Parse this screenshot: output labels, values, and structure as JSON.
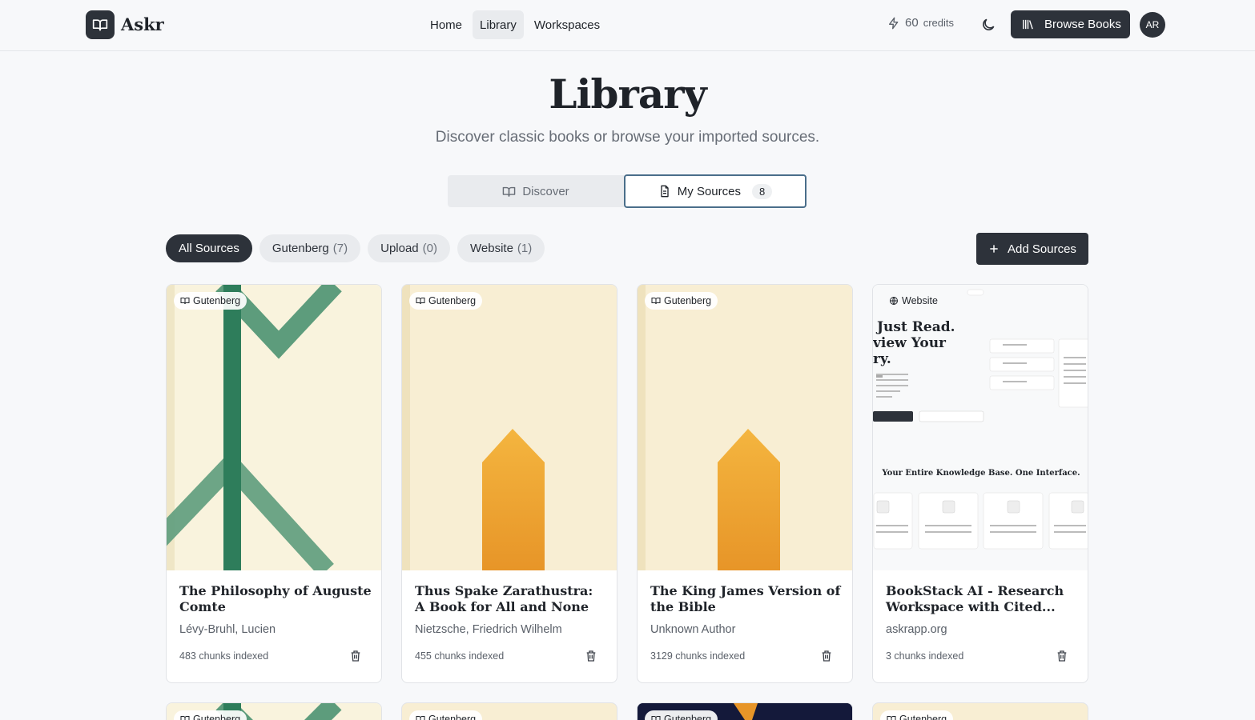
{
  "app": {
    "name": "Askr"
  },
  "nav": [
    {
      "label": "Home",
      "active": false
    },
    {
      "label": "Library",
      "active": true
    },
    {
      "label": "Workspaces",
      "active": false
    }
  ],
  "header": {
    "credits_value": "60",
    "credits_unit": "credits",
    "browse_label": "Browse Books",
    "avatar_initials": "AR"
  },
  "page": {
    "title": "Library",
    "subtitle": "Discover classic books or browse your imported sources."
  },
  "toggle": {
    "discover_label": "Discover",
    "sources_label": "My Sources",
    "sources_count": "8"
  },
  "filters": [
    {
      "label": "All Sources",
      "count": "",
      "active": true
    },
    {
      "label": "Gutenberg",
      "count": "(7)",
      "active": false
    },
    {
      "label": "Upload",
      "count": "(0)",
      "active": false
    },
    {
      "label": "Website",
      "count": "(1)",
      "active": false
    }
  ],
  "add_sources_label": "Add Sources",
  "cards": [
    {
      "source": "Gutenberg",
      "title": "The Philosophy of Auguste Comte",
      "author": "Lévy-Bruhl, Lucien",
      "chunks": "483 chunks indexed",
      "cover": "green"
    },
    {
      "source": "Gutenberg",
      "title": "Thus Spake Zarathustra: A Book for All and None",
      "author": "Nietzsche, Friedrich Wilhelm",
      "chunks": "455 chunks indexed",
      "cover": "gold"
    },
    {
      "source": "Gutenberg",
      "title": "The King James Version of the Bible",
      "author": "Unknown Author",
      "chunks": "3129 chunks indexed",
      "cover": "gold"
    },
    {
      "source": "Website",
      "title": "BookStack AI - Research Workspace with Cited...",
      "author": "askrapp.org",
      "chunks": "3 chunks indexed",
      "cover": "website"
    }
  ],
  "partial_cards": [
    {
      "source": "Gutenberg"
    },
    {
      "source": "Gutenberg"
    },
    {
      "source": "Gutenberg"
    },
    {
      "source": "Gutenberg"
    }
  ],
  "website_preview": {
    "hero_line1": "Just Read.",
    "hero_line2": "view Your",
    "hero_line3": "ry.",
    "section_title": "Your Entire Knowledge Base. One Interface."
  },
  "colors": {
    "primary": "#2d323a",
    "background": "#f7f8fa",
    "cover_cream": "#f8f1da",
    "cover_green": "#2e7d5b",
    "cover_gold": "#efa52f"
  }
}
